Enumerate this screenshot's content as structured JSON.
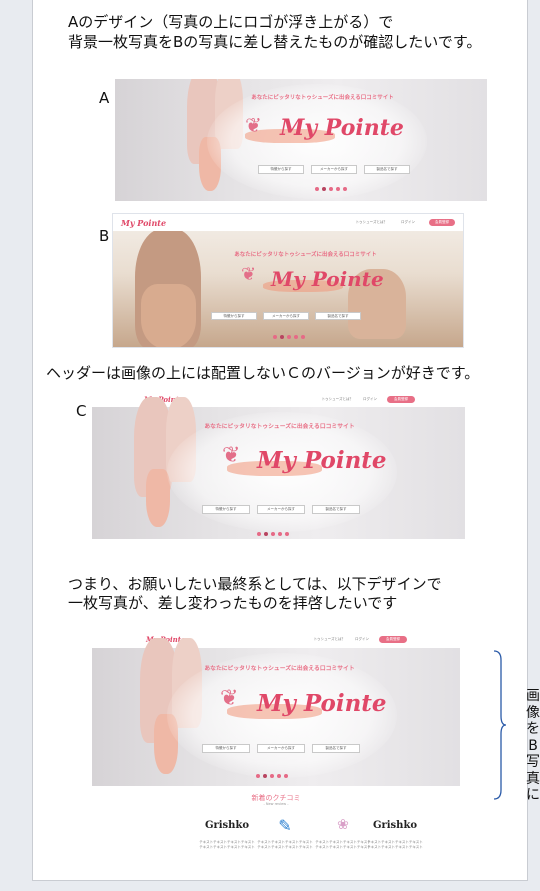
{
  "notes": {
    "intro_line1": "Aのデザイン（写真の上にロゴが浮き上がる）で",
    "intro_line2": "背景一枚写真をBの写真に差し替えたものが確認したいです。",
    "middle": "ヘッダーは画像の上には配置しないＣのバージョンが好きです。",
    "final_line1": "つまり、お願いしたい最終系としては、以下デザインで",
    "final_line2": "一枚写真が、差し変わったものを拝啓したいです",
    "side_note": "画像をB写真に"
  },
  "labels": {
    "a": "A",
    "b": "B",
    "c": "C"
  },
  "mockup": {
    "tagline": "あなたにピッタリなトゥシューズに出会える口コミサイト",
    "logo": "My Pointe",
    "buttons": [
      "特徴から探す",
      "メーカーから探す",
      "製品名で探す"
    ],
    "slide_count": 5,
    "active_slide": 1,
    "header": {
      "logo": "My Pointe",
      "links": [
        "トゥシューズとは？",
        "ログイン"
      ],
      "cta": "会員登録"
    },
    "section_title": "新着のクチコミ",
    "section_sub": "- New review -",
    "brands": [
      "Grishko",
      "",
      "",
      "Grishko"
    ],
    "brand_caption": "テキストテキストテキストテキストテキストテキストテキストテキスト"
  },
  "colors": {
    "accent": "#e86f86",
    "logo": "#e04868",
    "page_bg": "#e8ebf0"
  }
}
